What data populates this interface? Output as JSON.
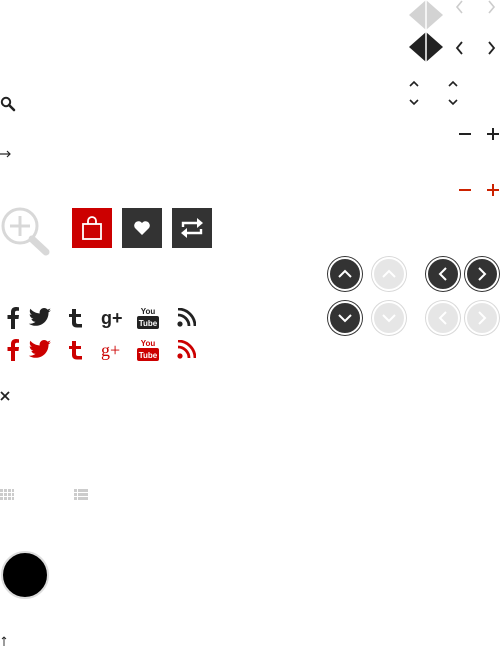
{
  "colors": {
    "dark": "#222222",
    "light_gray": "#d3d3d3",
    "red": "#cc0000",
    "charcoal": "#333333",
    "soft_gray": "#e4e4e4"
  },
  "icons": {
    "top_right": [
      "diamond-split-light-icon",
      "chevron-left-light-icon",
      "chevron-right-light-icon",
      "diamond-split-dark-icon",
      "chevron-left-icon",
      "chevron-right-icon"
    ],
    "carets": [
      "caret-up-icon",
      "caret-down-icon"
    ],
    "zoom": [
      "minus-icon",
      "plus-icon",
      "minus-red-icon",
      "plus-red-icon"
    ],
    "left_column": [
      "search-icon",
      "arrow-right-icon",
      "zoom-in-icon",
      "shopping-bag-icon",
      "heart-icon",
      "repeat-icon",
      "close-icon",
      "grid-view-icon",
      "list-view-icon",
      "black-circle",
      "arrow-up-icon"
    ],
    "social": [
      "facebook-icon",
      "twitter-icon",
      "tumblr-icon",
      "google-plus-icon",
      "youtube-icon",
      "rss-icon"
    ],
    "round_nav": [
      "circle-up-dark-icon",
      "circle-up-light-icon",
      "circle-left-dark-icon",
      "circle-right-dark-icon",
      "circle-down-dark-icon",
      "circle-down-light-icon",
      "circle-left-light-icon",
      "circle-right-light-icon"
    ]
  },
  "social": {
    "google_plus_glyph": "g+",
    "youtube_you": "You",
    "youtube_tube": "Tube"
  }
}
